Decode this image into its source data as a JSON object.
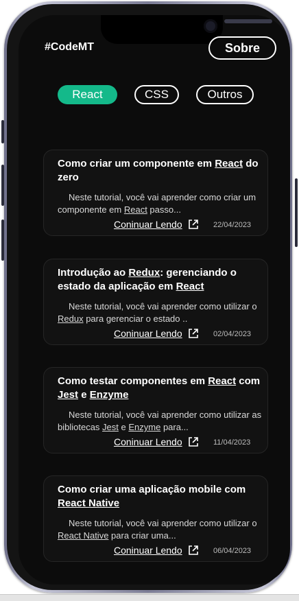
{
  "header": {
    "brand": "#CodeMT",
    "about_label": "Sobre"
  },
  "filters": [
    {
      "label": "React",
      "active": true
    },
    {
      "label": "CSS",
      "active": false
    },
    {
      "label": "Outros",
      "active": false
    }
  ],
  "colors": {
    "accent": "#14b98a",
    "background": "#0c0c0c",
    "card": "#121212"
  },
  "posts": [
    {
      "title_parts": [
        {
          "text": "Como criar um componente em ",
          "u": false
        },
        {
          "text": "React",
          "u": true
        },
        {
          "text": " do zero",
          "u": false
        }
      ],
      "desc_parts": [
        {
          "text": "Neste tutorial, você vai aprender como criar um componente em ",
          "u": false
        },
        {
          "text": "React",
          "u": true
        },
        {
          "text": " passo...",
          "u": false
        }
      ],
      "link_label": "Coninuar Lendo",
      "date": "22/04/2023"
    },
    {
      "title_parts": [
        {
          "text": "Introdução ao ",
          "u": false
        },
        {
          "text": "Redux",
          "u": true
        },
        {
          "text": ": gerenciando o estado da aplicação em ",
          "u": false
        },
        {
          "text": "React",
          "u": true
        }
      ],
      "desc_parts": [
        {
          "text": "Neste tutorial, você vai aprender como utilizar o ",
          "u": false
        },
        {
          "text": "Redux",
          "u": true
        },
        {
          "text": " para gerenciar o estado ..",
          "u": false
        }
      ],
      "link_label": "Coninuar Lendo",
      "date": "02/04/2023"
    },
    {
      "title_parts": [
        {
          "text": "Como testar componentes em ",
          "u": false
        },
        {
          "text": "React",
          "u": true
        },
        {
          "text": " com ",
          "u": false
        },
        {
          "text": "Jest",
          "u": true
        },
        {
          "text": " e ",
          "u": false
        },
        {
          "text": "Enzyme",
          "u": true
        }
      ],
      "desc_parts": [
        {
          "text": "Neste tutorial, você vai aprender como utilizar as bibliotecas ",
          "u": false
        },
        {
          "text": "Jest",
          "u": true
        },
        {
          "text": " e ",
          "u": false
        },
        {
          "text": "Enzyme",
          "u": true
        },
        {
          "text": " para...",
          "u": false
        }
      ],
      "link_label": "Coninuar Lendo",
      "date": "11/04/2023"
    },
    {
      "title_parts": [
        {
          "text": "Como criar uma aplicação mobile com ",
          "u": false
        },
        {
          "text": "React Native",
          "u": true
        }
      ],
      "desc_parts": [
        {
          "text": "Neste tutorial, você vai aprender como utilizar o ",
          "u": false
        },
        {
          "text": "React Native",
          "u": true
        },
        {
          "text": " para criar uma...",
          "u": false
        }
      ],
      "link_label": "Coninuar Lendo",
      "date": "06/04/2023"
    }
  ]
}
